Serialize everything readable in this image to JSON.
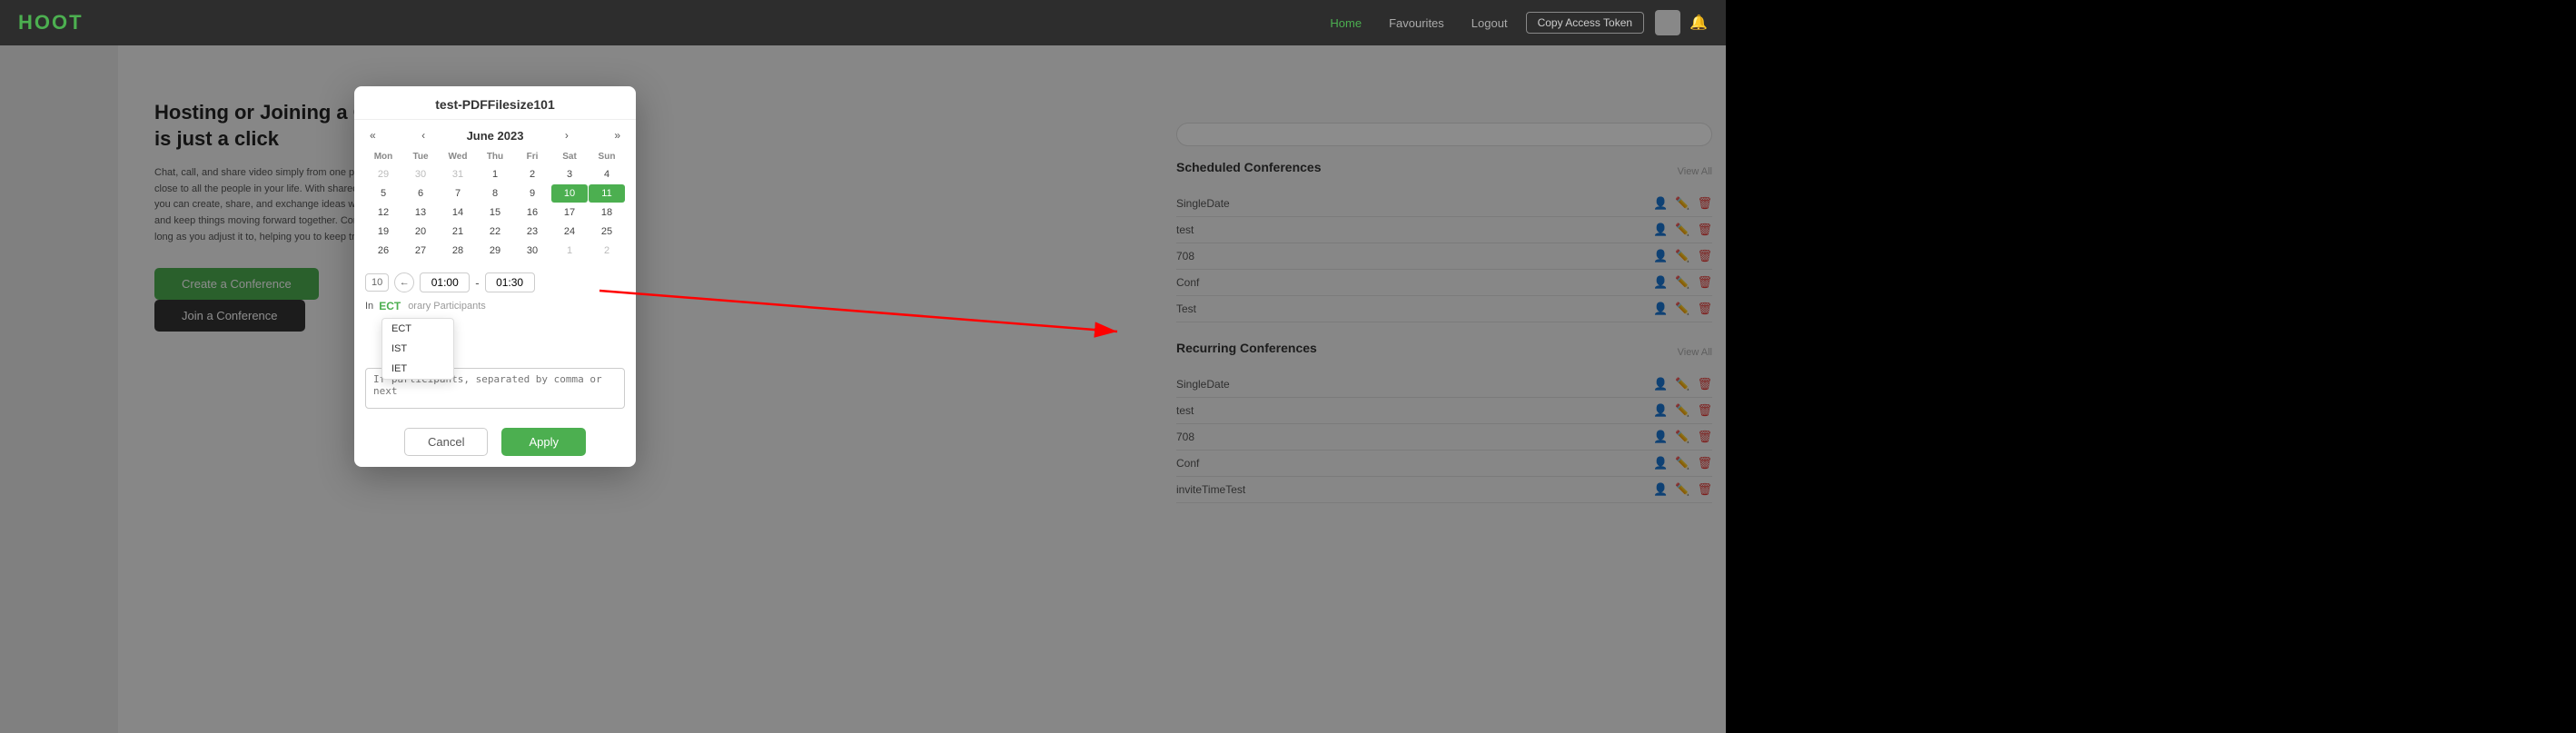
{
  "app": {
    "logo": "HOOT",
    "nav": {
      "home": "Home",
      "favourites": "Favourites",
      "logout": "Logout",
      "copy_token": "Copy Access Token"
    }
  },
  "hero": {
    "title": "Hosting or Joining a Conference is just a click",
    "text": "Chat, call, and share video simply from one place that helps you stay close to all the people in your life. With shared links. Always available, you can create, share, and exchange ideas whenever you want to and keep things moving forward together. Conference stays active as long as you adjust it to, helping you to keep track of all your actions.",
    "create_btn": "Create a Conference",
    "join_btn": "Join a Conference"
  },
  "sections": {
    "scheduled": {
      "title": "Scheduled Conferences",
      "view_all": "View All",
      "items": [
        {
          "name": "SingleDate"
        },
        {
          "name": "test"
        },
        {
          "name": "708"
        },
        {
          "name": "Conf"
        },
        {
          "name": "Test"
        }
      ]
    },
    "recurring": {
      "title": "Recurring Conferences",
      "view_all": "View All",
      "items": [
        {
          "name": "SingleDate"
        },
        {
          "name": "test"
        },
        {
          "name": "708"
        },
        {
          "name": "Conf"
        },
        {
          "name": "inviteTimeTest"
        }
      ]
    }
  },
  "modal": {
    "title": "test-PDFFilesize101",
    "calendar": {
      "month": "June 2023",
      "headers": [
        "Mon",
        "Tue",
        "Wed",
        "Thu",
        "Fri",
        "Sat",
        "Sun"
      ],
      "rows": [
        [
          "29",
          "30",
          "31",
          "1",
          "2",
          "3",
          "4"
        ],
        [
          "5",
          "6",
          "7",
          "8",
          "9",
          "10",
          "11"
        ],
        [
          "12",
          "13",
          "14",
          "15",
          "16",
          "17",
          "18"
        ],
        [
          "19",
          "20",
          "21",
          "22",
          "23",
          "24",
          "25"
        ],
        [
          "26",
          "27",
          "28",
          "29",
          "30",
          "1",
          "2"
        ]
      ],
      "selected_start": "10",
      "selected_end": "11"
    },
    "time": {
      "date_display": "10",
      "start": "01:00",
      "separator": "-",
      "end": "01:30"
    },
    "timezone": {
      "label": "In",
      "selected": "ECT",
      "options": [
        "ECT",
        "IST",
        "IET"
      ]
    },
    "participants": {
      "label": "Temporary Participants",
      "placeholder": "If participants, separated by comma or next"
    },
    "buttons": {
      "cancel": "Cancel",
      "apply": "Apply"
    }
  }
}
